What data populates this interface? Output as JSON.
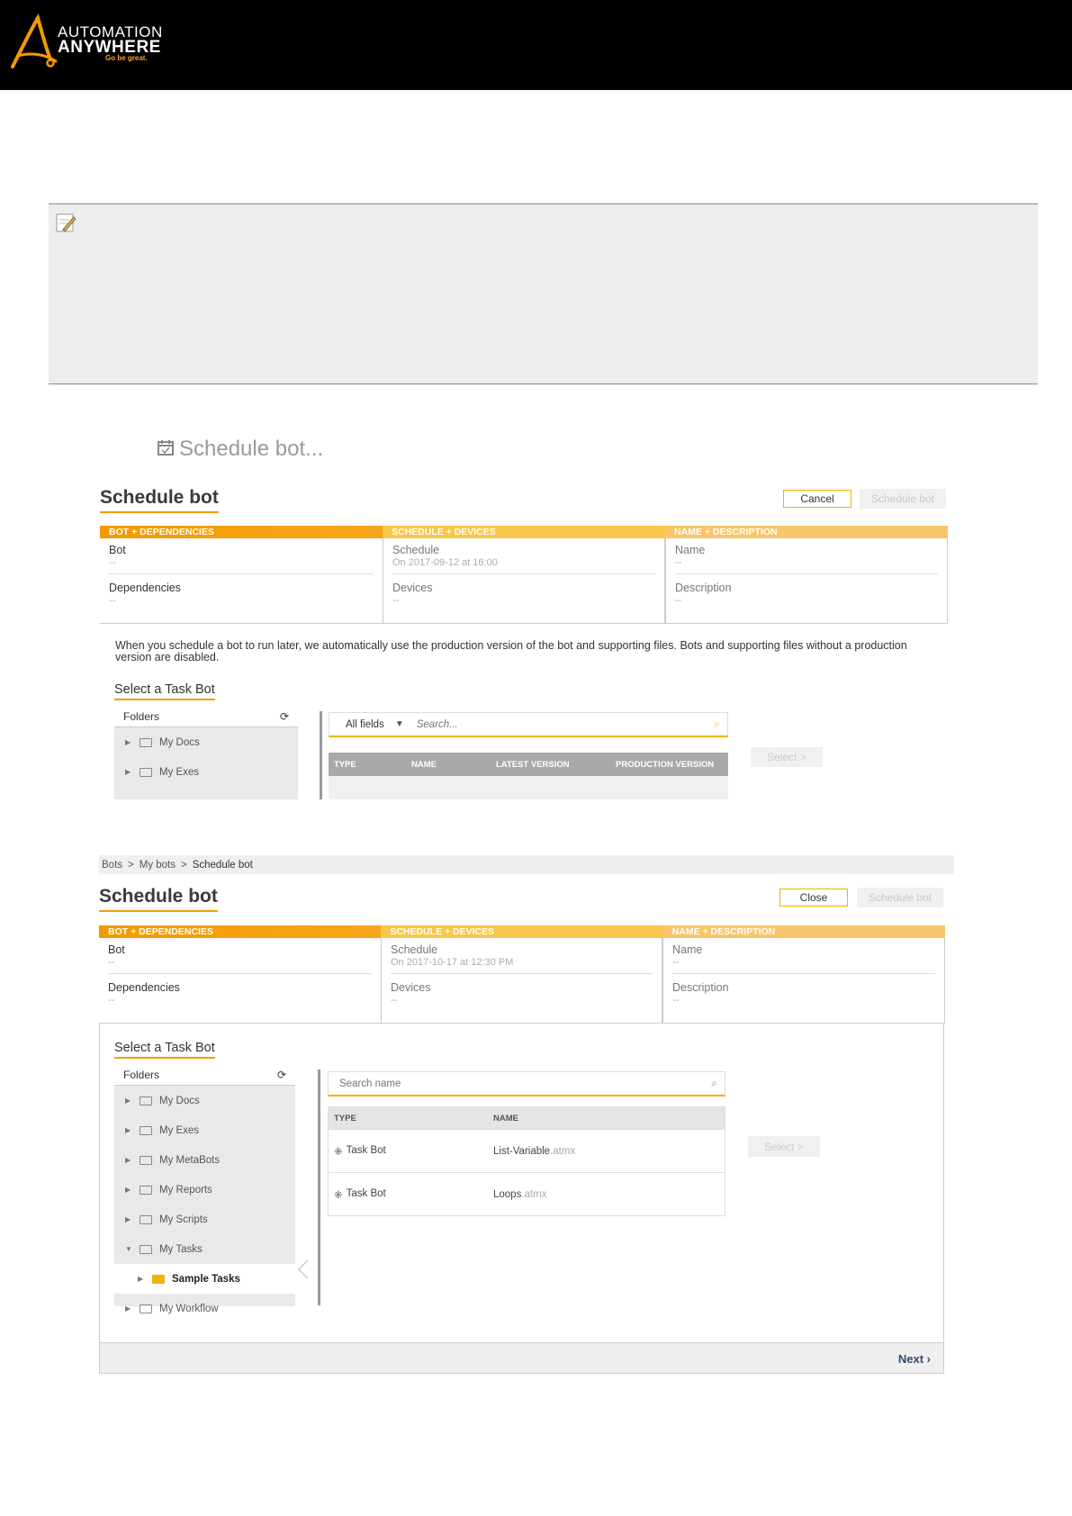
{
  "header": {
    "brand_line1": "AUTOMATION",
    "brand_line2": "ANYWHERE",
    "tagline": "Go be great."
  },
  "schedule_link": "Schedule bot...",
  "panel1": {
    "title": "Schedule bot",
    "cancel_label": "Cancel",
    "schedule_label": "Schedule bot",
    "steps": [
      "BOT + DEPENDENCIES",
      "SCHEDULE + DEVICES",
      "NAME + DESCRIPTION"
    ],
    "bot_label": "Bot",
    "bot_value": "--",
    "deps_label": "Dependencies",
    "deps_value": "--",
    "sched_label": "Schedule",
    "sched_value": "On 2017-09-12 at 16:00",
    "devices_label": "Devices",
    "devices_value": "--",
    "name_label": "Name",
    "name_value": "--",
    "desc_label": "Description",
    "desc_value": "--",
    "info_text": "When you schedule a bot to run later, we automatically use the production version of the bot and supporting files. Bots and supporting files without a production version are disabled.",
    "section_title": "Select a Task Bot",
    "folders_label": "Folders",
    "folders": [
      "My Docs",
      "My Exes"
    ],
    "filter_label": "All fields",
    "search_placeholder": "Search...",
    "columns": [
      "TYPE",
      "NAME",
      "LATEST VERSION",
      "PRODUCTION VERSION"
    ],
    "select_label": "Select >"
  },
  "panel2": {
    "breadcrumb": [
      "Bots",
      ">",
      "My bots",
      ">",
      "Schedule bot"
    ],
    "title": "Schedule bot",
    "close_label": "Close",
    "schedule_label": "Schedule bot",
    "steps": [
      "BOT + DEPENDENCIES",
      "SCHEDULE + DEVICES",
      "NAME + DESCRIPTION"
    ],
    "bot_label": "Bot",
    "bot_value": "--",
    "deps_label": "Dependencies",
    "deps_value": "--",
    "sched_label": "Schedule",
    "sched_value": "On 2017-10-17 at 12:30 PM",
    "devices_label": "Devices",
    "devices_value": "--",
    "name_label": "Name",
    "name_value": "--",
    "desc_label": "Description",
    "desc_value": "--",
    "section_title": "Select a Task Bot",
    "folders_label": "Folders",
    "folders": [
      "My Docs",
      "My Exes",
      "My MetaBots",
      "My Reports",
      "My Scripts",
      "My Tasks"
    ],
    "subfolder": "Sample Tasks",
    "last_folder": "My Workflow",
    "search_placeholder": "Search name",
    "columns": [
      "TYPE",
      "NAME"
    ],
    "rows": [
      {
        "type": "Task Bot",
        "name": "List-Variable",
        "ext": ".atmx"
      },
      {
        "type": "Task Bot",
        "name": "Loops",
        "ext": ".atmx"
      }
    ],
    "select_label": "Select >",
    "next_label": "Next"
  },
  "colors": {
    "accent": "#f2b300",
    "step1": "#f39a00",
    "step2": "#f9c64d",
    "header_bg": "#000000"
  }
}
